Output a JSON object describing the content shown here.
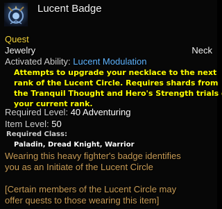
{
  "item": {
    "icon": "badge-icon",
    "name": "Lucent Badge",
    "quest_tag": "Quest",
    "slot_type": "Jewelry",
    "slot_name": "Neck",
    "ability_label": "Activated Ability:",
    "ability_name": "Lucent Modulation",
    "description_lines": [
      "Attempts to upgrade your necklace to the next",
      "rank of the Lucent Circle. Requires shards from",
      "the Tranquil Thought and Hero's Strength trials of",
      "your current rank."
    ],
    "required_level_label": "Required Level:",
    "required_level_value": "40 Adventuring",
    "item_level_label": "Item Level:",
    "item_level_value": "50",
    "required_class_label": "Required Class:",
    "required_classes": "Paladin, Dread Knight, Warrior",
    "flavor_lines": [
      "Wearing this heavy fighter's badge identifies",
      "you as an Initiate of the Lucent Circle"
    ],
    "note_lines": [
      "[Certain members of the Lucent Circle may",
      "offer quests to those wearing this item]"
    ]
  },
  "colors": {
    "quest": "#f3d33a",
    "ability_name": "#5fb4ff",
    "description": "#ffff00",
    "flavor": "#c79b55"
  }
}
